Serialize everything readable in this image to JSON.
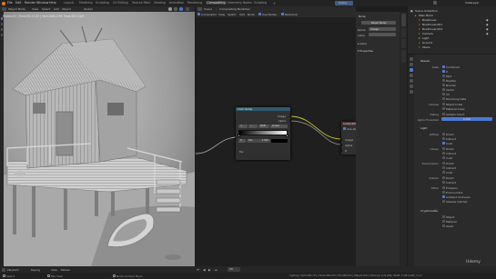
{
  "menu": {
    "items": [
      "File",
      "Edit",
      "Render",
      "Window",
      "Help"
    ],
    "tabs": [
      "Layout",
      "Modeling",
      "Sculpting",
      "UV Editing",
      "Texture Paint",
      "Shading",
      "Animation",
      "Rendering",
      "Compositing",
      "Geometry Nodes",
      "Scripting"
    ],
    "active_tab": "Compositing",
    "scene_label": "Scene",
    "view_layer": "ViewLayer"
  },
  "viewport": {
    "mode": "Object Mode",
    "view": "View",
    "select": "Select",
    "add": "Add",
    "object": "Object",
    "global": "Global",
    "info_line": "Frame:23 | Time:00:23.00 | Mem:608.17M, Peak:623.41M"
  },
  "compositor": {
    "editor": "Compositor",
    "use_nodes": "Use Nodes",
    "view": "View",
    "select": "Select",
    "add": "Add",
    "node": "Node",
    "backdrop": "Backdrop",
    "scene": "Scene",
    "breadcrumb": "Compositing Nodetree"
  },
  "nodes": {
    "ramp": {
      "title": "Color Ramp",
      "out_image": "Image",
      "out_alpha": "Alpha",
      "mode": "RGB",
      "interp": "Linear",
      "pos_label": "Pos",
      "pos_value": "0.000",
      "index": "0",
      "fac": "Fac"
    },
    "comp": {
      "title": "Composite",
      "use_alpha": "Use Alpha",
      "image": "Image",
      "alpha": "Alpha",
      "z": "Z"
    }
  },
  "npanel": {
    "header": "Node",
    "reset": "Reset Node",
    "name_label": "Name",
    "name_value": "Image",
    "label_label": "Label",
    "color": "Color",
    "properties": "Properties"
  },
  "vtabs": [
    "Node",
    "Tool",
    "View",
    "Options"
  ],
  "outliner": {
    "title": "Scene Collection",
    "rows": [
      "Scene Collection",
      "Main Build",
      "BoatCover",
      "BoatCover.001",
      "BoatCover.002",
      "Camera",
      "Light",
      "Ground",
      "Stairs"
    ]
  },
  "props": {
    "passes_header": "Passes",
    "data_header": "Data",
    "combined": "Combined",
    "z": "Z",
    "mist": "Mist",
    "position": "Position",
    "normal": "Normal",
    "vector": "Vector",
    "uv": "UV",
    "denoising": "Denoising Data",
    "indexes": "Indexes",
    "object_index": "Object Index",
    "material_index": "Material Index",
    "debug": "Debug",
    "sample_count": "Sample Count",
    "alpha_threshold_label": "Alpha Threshold",
    "alpha_threshold": "0.500",
    "light_header": "Light",
    "diffuse": "Diffuse",
    "glossy": "Glossy",
    "transmission": "Transmission",
    "volume": "Volume",
    "other": "Other",
    "direct": "Direct",
    "indirect": "Indirect",
    "color": "Color",
    "emission": "Emission",
    "environment": "Environment",
    "ambient_occlusion": "Ambient Occlusion",
    "shadow_catcher": "Shadow Catcher",
    "cryptomatte_header": "Cryptomatte",
    "object": "Object",
    "material": "Material",
    "asset": "Asset"
  },
  "timeline": {
    "playback": "Playback",
    "keying": "Keying",
    "view": "View",
    "marker": "Marker",
    "current_frame": "23"
  },
  "status": {
    "left1": "Select",
    "left2": "Pan View",
    "left3": "Node Context Menu",
    "right": "Lighting | Verts:481,791 | Faces:469,272 | Tris:938,544 | Objects:0/21 | Memory: 2.21 GiB | VRAM: 2.1/8.0 GiB | 3.1.0"
  },
  "watermark": "Udemy",
  "colors": {
    "accent": "#4b7ad0",
    "node_header": "#2d5a6b",
    "image_socket": "#c7c729",
    "float_socket": "#a1a1a1"
  }
}
